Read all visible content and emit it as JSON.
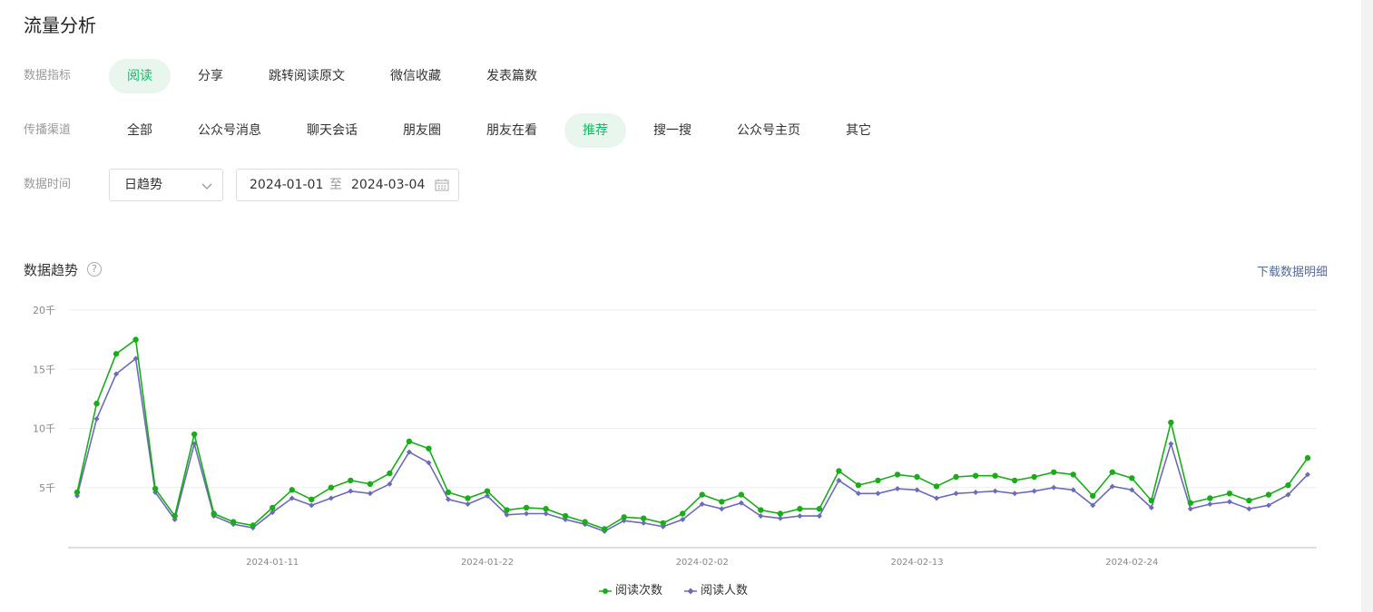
{
  "page": {
    "title": "流量分析"
  },
  "filters": {
    "metric": {
      "label": "数据指标",
      "options": [
        "阅读",
        "分享",
        "跳转阅读原文",
        "微信收藏",
        "发表篇数"
      ],
      "active": 0
    },
    "channel": {
      "label": "传播渠道",
      "options": [
        "全部",
        "公众号消息",
        "聊天会话",
        "朋友圈",
        "朋友在看",
        "推荐",
        "搜一搜",
        "公众号主页",
        "其它"
      ],
      "active": 5
    },
    "time": {
      "label": "数据时间",
      "granularity": "日趋势",
      "start": "2024-01-01",
      "separator": "至",
      "end": "2024-03-04"
    }
  },
  "section": {
    "title": "数据趋势",
    "help": "?",
    "download": "下载数据明细"
  },
  "colors": {
    "accent": "#07c160",
    "series1": "#1aad19",
    "series2": "#6b6bb8",
    "active_bg": "#e8f6ee",
    "link": "#576b95"
  },
  "chart_data": {
    "type": "line",
    "ylim": [
      0,
      20000
    ],
    "y_ticks": [
      {
        "value": 5000,
        "label": "5千"
      },
      {
        "value": 10000,
        "label": "10千"
      },
      {
        "value": 15000,
        "label": "15千"
      },
      {
        "value": 20000,
        "label": "20千"
      }
    ],
    "x_start": "2024-01-01",
    "x_tick_labels": [
      "2024-01-11",
      "2024-01-22",
      "2024-02-02",
      "2024-02-13",
      "2024-02-24"
    ],
    "grid": true,
    "legend_position": "bottom-center",
    "series": [
      {
        "name": "阅读次数",
        "marker": "circle",
        "values": [
          4600,
          12100,
          16300,
          17500,
          4900,
          2600,
          9500,
          2800,
          2100,
          1800,
          3300,
          4800,
          4000,
          5000,
          5600,
          5300,
          6200,
          8900,
          8300,
          4600,
          4100,
          4700,
          3100,
          3300,
          3200,
          2600,
          2100,
          1500,
          2500,
          2400,
          2000,
          2800,
          4400,
          3800,
          4400,
          3100,
          2800,
          3200,
          3200,
          6400,
          5200,
          5600,
          6100,
          5900,
          5100,
          5900,
          6000,
          6000,
          5600,
          5900,
          6300,
          6100,
          4300,
          6300,
          5800,
          3900,
          10500,
          3700,
          4100,
          4500,
          3900,
          4400,
          5200,
          7500
        ]
      },
      {
        "name": "阅读人数",
        "marker": "diamond",
        "values": [
          4300,
          10800,
          14600,
          15900,
          4600,
          2300,
          8700,
          2600,
          1900,
          1600,
          2900,
          4100,
          3500,
          4100,
          4700,
          4500,
          5300,
          8000,
          7100,
          4000,
          3600,
          4300,
          2700,
          2800,
          2800,
          2300,
          1900,
          1300,
          2200,
          2000,
          1700,
          2300,
          3600,
          3200,
          3700,
          2600,
          2400,
          2600,
          2600,
          5600,
          4500,
          4500,
          4900,
          4800,
          4100,
          4500,
          4600,
          4700,
          4500,
          4700,
          5000,
          4800,
          3500,
          5100,
          4800,
          3300,
          8700,
          3200,
          3600,
          3800,
          3200,
          3500,
          4400,
          6100
        ]
      }
    ]
  }
}
